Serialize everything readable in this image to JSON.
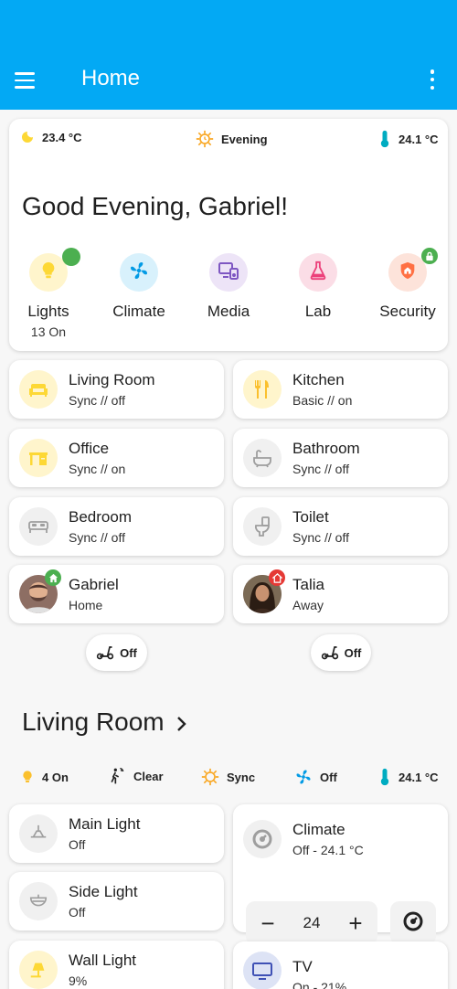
{
  "appbar": {
    "title": "Home"
  },
  "header_chips": {
    "outdoor_temp": "23.4 °C",
    "time_of_day": "Evening",
    "indoor_temp": "24.1 °C"
  },
  "greeting": "Good Evening, Gabriel!",
  "categories": [
    {
      "label": "Lights",
      "sub": "13 On",
      "icon": "bulb-icon"
    },
    {
      "label": "Climate",
      "sub": "",
      "icon": "fan-icon"
    },
    {
      "label": "Media",
      "sub": "",
      "icon": "media-icon"
    },
    {
      "label": "Lab",
      "sub": "",
      "icon": "flask-icon"
    },
    {
      "label": "Security",
      "sub": "",
      "icon": "shield-home-icon"
    }
  ],
  "rooms": [
    {
      "name": "Living Room",
      "status": "Sync // off",
      "icon": "sofa-icon"
    },
    {
      "name": "Kitchen",
      "status": "Basic // on",
      "icon": "silverware-icon"
    },
    {
      "name": "Office",
      "status": "Sync // on",
      "icon": "desk-icon"
    },
    {
      "name": "Bathroom",
      "status": "Sync // off",
      "icon": "bathtub-icon"
    },
    {
      "name": "Bedroom",
      "status": "Sync // off",
      "icon": "bed-icon"
    },
    {
      "name": "Toilet",
      "status": "Sync // off",
      "icon": "toilet-icon"
    }
  ],
  "people": [
    {
      "name": "Gabriel",
      "status": "Home"
    },
    {
      "name": "Talia",
      "status": "Away"
    }
  ],
  "scooters": [
    {
      "state": "Off",
      "icon": "scooter-icon"
    },
    {
      "state": "Off",
      "icon": "scooter-icon"
    }
  ],
  "living_room": {
    "title": "Living Room",
    "chips": {
      "lights": "4 On",
      "motion": "Clear",
      "sync": "Sync",
      "fan": "Off",
      "temp": "24.1 °C"
    },
    "devices": [
      {
        "name": "Main Light",
        "status": "Off",
        "icon": "ceiling-light-icon"
      },
      {
        "name": "Side Light",
        "status": "Off",
        "icon": "lamp-icon"
      },
      {
        "name": "Wall Light",
        "status": "9%",
        "icon": "wall-sconce-icon"
      }
    ],
    "climate": {
      "name": "Climate",
      "status": "Off - 24.1 °C",
      "setpoint": "24",
      "minus": "−",
      "plus": "+"
    },
    "tv": {
      "name": "TV",
      "status": "On - 21%"
    }
  },
  "colors": {
    "appbar": "#03a9f4",
    "light_yellow": "#fdd835",
    "climate_blue": "#039be5",
    "media_purple": "#7e57c2",
    "lab_pink": "#ec407a",
    "security_orange": "#ff7043",
    "green_badge": "#4caf50",
    "red_badge": "#e53935"
  }
}
